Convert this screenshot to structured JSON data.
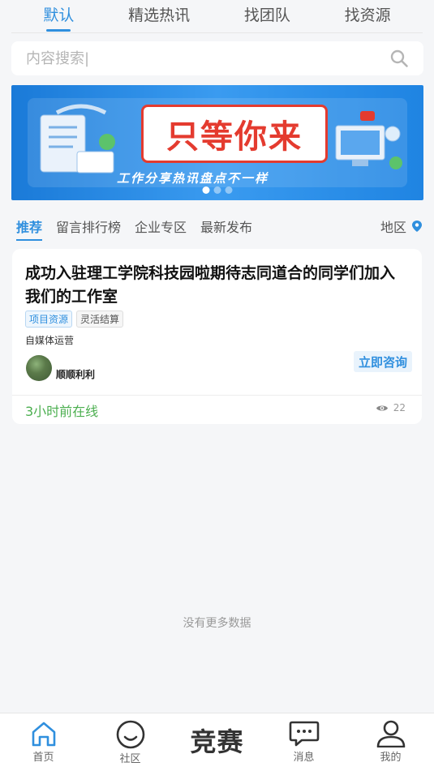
{
  "top_tabs": [
    "默认",
    "精选热讯",
    "找团队",
    "找资源"
  ],
  "search": {
    "placeholder": "内容搜索|"
  },
  "banner": {
    "title": "只等你来",
    "subtitle": "工作分享热讯盘点不一样"
  },
  "category_tabs": [
    "推荐",
    "留言排行榜",
    "企业专区",
    "最新发布"
  ],
  "region_label": "地区",
  "card": {
    "title": "成功入驻理工学院科技园啦期待志同道合的同学们加入我们的工作室",
    "tags": [
      "项目资源",
      "灵活结算"
    ],
    "subtitle": "自媒体运营",
    "user": "顺顺利利",
    "consult_label": "立即咨询",
    "online": "3小时前在线",
    "views": "22"
  },
  "no_more": "没有更多数据",
  "bottom_nav": {
    "home": "首页",
    "community": "社区",
    "center": "竞赛",
    "messages": "消息",
    "mine": "我的"
  },
  "colors": {
    "accent": "#2f8fde",
    "online": "#4caf50"
  }
}
